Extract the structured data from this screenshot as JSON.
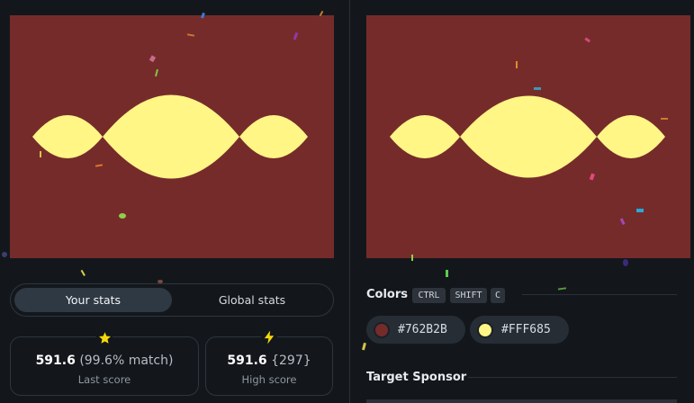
{
  "colors": {
    "background": "#762B2B",
    "shape": "#FFF685"
  },
  "stats": {
    "tabs": [
      "Your stats",
      "Global stats"
    ],
    "active_tab": "Your stats",
    "last": {
      "score": "591.6",
      "detail": "(99.6% match)",
      "label": "Last score",
      "icon": "star-icon"
    },
    "high": {
      "score": "591.6",
      "detail": "{297}",
      "label": "High score",
      "icon": "lightning-icon"
    }
  },
  "colors_section": {
    "title": "Colors",
    "shortcuts": [
      "CTRL",
      "SHIFT",
      "C"
    ],
    "swatches": [
      {
        "hex": "#762B2B",
        "color": "#762B2B"
      },
      {
        "hex": "#FFF685",
        "color": "#FFF685"
      }
    ]
  },
  "sponsor_section": {
    "title": "Target Sponsor"
  }
}
